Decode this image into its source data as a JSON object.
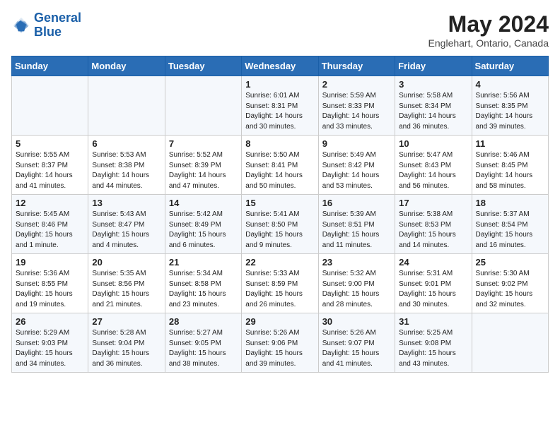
{
  "logo": {
    "line1": "General",
    "line2": "Blue"
  },
  "title": "May 2024",
  "location": "Englehart, Ontario, Canada",
  "days_of_week": [
    "Sunday",
    "Monday",
    "Tuesday",
    "Wednesday",
    "Thursday",
    "Friday",
    "Saturday"
  ],
  "weeks": [
    [
      {
        "day": "",
        "info": ""
      },
      {
        "day": "",
        "info": ""
      },
      {
        "day": "",
        "info": ""
      },
      {
        "day": "1",
        "info": "Sunrise: 6:01 AM\nSunset: 8:31 PM\nDaylight: 14 hours\nand 30 minutes."
      },
      {
        "day": "2",
        "info": "Sunrise: 5:59 AM\nSunset: 8:33 PM\nDaylight: 14 hours\nand 33 minutes."
      },
      {
        "day": "3",
        "info": "Sunrise: 5:58 AM\nSunset: 8:34 PM\nDaylight: 14 hours\nand 36 minutes."
      },
      {
        "day": "4",
        "info": "Sunrise: 5:56 AM\nSunset: 8:35 PM\nDaylight: 14 hours\nand 39 minutes."
      }
    ],
    [
      {
        "day": "5",
        "info": "Sunrise: 5:55 AM\nSunset: 8:37 PM\nDaylight: 14 hours\nand 41 minutes."
      },
      {
        "day": "6",
        "info": "Sunrise: 5:53 AM\nSunset: 8:38 PM\nDaylight: 14 hours\nand 44 minutes."
      },
      {
        "day": "7",
        "info": "Sunrise: 5:52 AM\nSunset: 8:39 PM\nDaylight: 14 hours\nand 47 minutes."
      },
      {
        "day": "8",
        "info": "Sunrise: 5:50 AM\nSunset: 8:41 PM\nDaylight: 14 hours\nand 50 minutes."
      },
      {
        "day": "9",
        "info": "Sunrise: 5:49 AM\nSunset: 8:42 PM\nDaylight: 14 hours\nand 53 minutes."
      },
      {
        "day": "10",
        "info": "Sunrise: 5:47 AM\nSunset: 8:43 PM\nDaylight: 14 hours\nand 56 minutes."
      },
      {
        "day": "11",
        "info": "Sunrise: 5:46 AM\nSunset: 8:45 PM\nDaylight: 14 hours\nand 58 minutes."
      }
    ],
    [
      {
        "day": "12",
        "info": "Sunrise: 5:45 AM\nSunset: 8:46 PM\nDaylight: 15 hours\nand 1 minute."
      },
      {
        "day": "13",
        "info": "Sunrise: 5:43 AM\nSunset: 8:47 PM\nDaylight: 15 hours\nand 4 minutes."
      },
      {
        "day": "14",
        "info": "Sunrise: 5:42 AM\nSunset: 8:49 PM\nDaylight: 15 hours\nand 6 minutes."
      },
      {
        "day": "15",
        "info": "Sunrise: 5:41 AM\nSunset: 8:50 PM\nDaylight: 15 hours\nand 9 minutes."
      },
      {
        "day": "16",
        "info": "Sunrise: 5:39 AM\nSunset: 8:51 PM\nDaylight: 15 hours\nand 11 minutes."
      },
      {
        "day": "17",
        "info": "Sunrise: 5:38 AM\nSunset: 8:53 PM\nDaylight: 15 hours\nand 14 minutes."
      },
      {
        "day": "18",
        "info": "Sunrise: 5:37 AM\nSunset: 8:54 PM\nDaylight: 15 hours\nand 16 minutes."
      }
    ],
    [
      {
        "day": "19",
        "info": "Sunrise: 5:36 AM\nSunset: 8:55 PM\nDaylight: 15 hours\nand 19 minutes."
      },
      {
        "day": "20",
        "info": "Sunrise: 5:35 AM\nSunset: 8:56 PM\nDaylight: 15 hours\nand 21 minutes."
      },
      {
        "day": "21",
        "info": "Sunrise: 5:34 AM\nSunset: 8:58 PM\nDaylight: 15 hours\nand 23 minutes."
      },
      {
        "day": "22",
        "info": "Sunrise: 5:33 AM\nSunset: 8:59 PM\nDaylight: 15 hours\nand 26 minutes."
      },
      {
        "day": "23",
        "info": "Sunrise: 5:32 AM\nSunset: 9:00 PM\nDaylight: 15 hours\nand 28 minutes."
      },
      {
        "day": "24",
        "info": "Sunrise: 5:31 AM\nSunset: 9:01 PM\nDaylight: 15 hours\nand 30 minutes."
      },
      {
        "day": "25",
        "info": "Sunrise: 5:30 AM\nSunset: 9:02 PM\nDaylight: 15 hours\nand 32 minutes."
      }
    ],
    [
      {
        "day": "26",
        "info": "Sunrise: 5:29 AM\nSunset: 9:03 PM\nDaylight: 15 hours\nand 34 minutes."
      },
      {
        "day": "27",
        "info": "Sunrise: 5:28 AM\nSunset: 9:04 PM\nDaylight: 15 hours\nand 36 minutes."
      },
      {
        "day": "28",
        "info": "Sunrise: 5:27 AM\nSunset: 9:05 PM\nDaylight: 15 hours\nand 38 minutes."
      },
      {
        "day": "29",
        "info": "Sunrise: 5:26 AM\nSunset: 9:06 PM\nDaylight: 15 hours\nand 39 minutes."
      },
      {
        "day": "30",
        "info": "Sunrise: 5:26 AM\nSunset: 9:07 PM\nDaylight: 15 hours\nand 41 minutes."
      },
      {
        "day": "31",
        "info": "Sunrise: 5:25 AM\nSunset: 9:08 PM\nDaylight: 15 hours\nand 43 minutes."
      },
      {
        "day": "",
        "info": ""
      }
    ]
  ]
}
